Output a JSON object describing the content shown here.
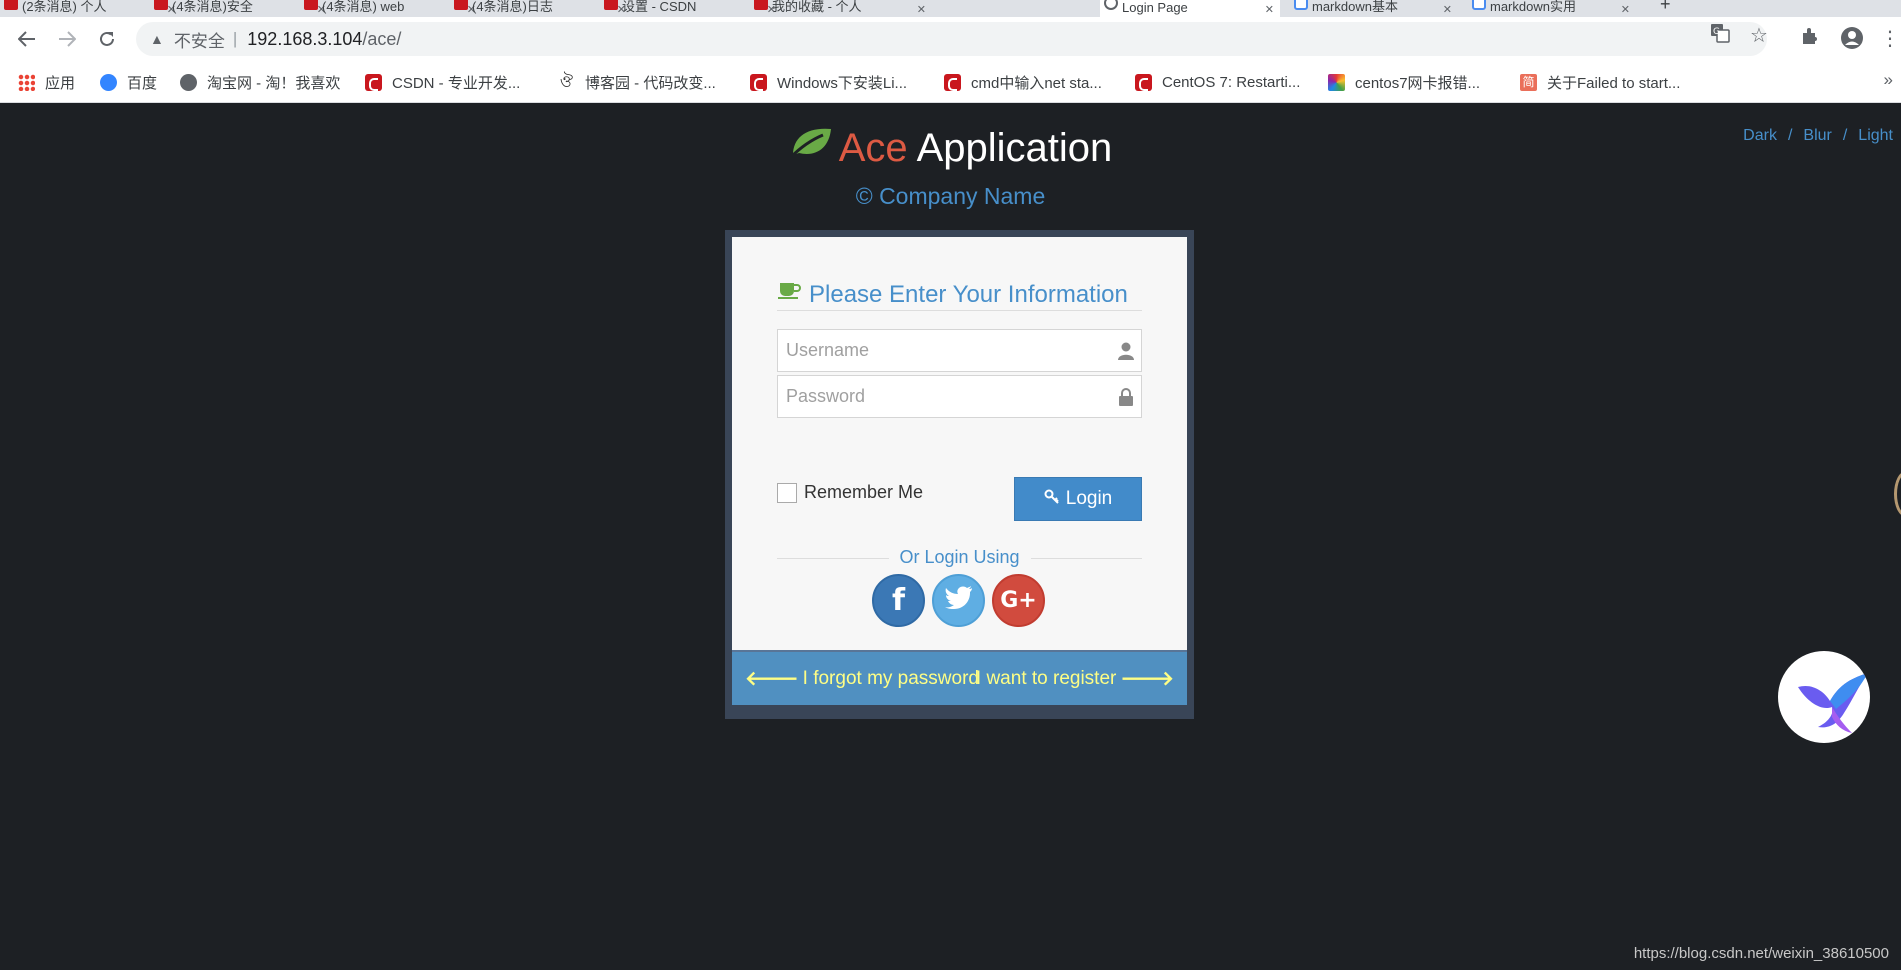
{
  "browser": {
    "tabs": [
      {
        "label": "(2条消息) 个人"
      },
      {
        "label": "(4条消息)安全"
      },
      {
        "label": "(4条消息) web"
      },
      {
        "label": "(4条消息)日志"
      },
      {
        "label": "设置 - CSDN"
      },
      {
        "label": "我的收藏 - 个人"
      },
      {
        "label": "Login Page"
      },
      {
        "label": "markdown基本"
      },
      {
        "label": "markdown实用"
      }
    ],
    "address": {
      "security_label": "不安全",
      "host": "192.168.3.104",
      "path": "/ace/"
    },
    "bookmarks": [
      {
        "label": "应用",
        "icon": "apps-grid-icon"
      },
      {
        "label": "百度",
        "icon": "baidu-paw-icon"
      },
      {
        "label": "淘宝网 - 淘！我喜欢",
        "icon": "globe-icon"
      },
      {
        "label": "CSDN - 专业开发...",
        "icon": "csdn-icon"
      },
      {
        "label": "博客园 - 代码改变...",
        "icon": "cnblogs-icon"
      },
      {
        "label": "Windows下安装Li...",
        "icon": "csdn-icon"
      },
      {
        "label": "cmd中输入net sta...",
        "icon": "csdn-icon"
      },
      {
        "label": "CentOS 7: Restarti...",
        "icon": "csdn-icon"
      },
      {
        "label": "centos7网卡报错...",
        "icon": "rainbow-icon"
      },
      {
        "label": "关于Failed to start...",
        "icon": "jianshu-icon"
      }
    ],
    "bookmarks_more": "»"
  },
  "page": {
    "theme_switch": [
      "Dark",
      "Blur",
      "Light"
    ],
    "theme_separator": "/",
    "brand": {
      "accent": "Ace",
      "rest": "Application"
    },
    "company": "© Company Name",
    "login": {
      "title": "Please Enter Your Information",
      "username_placeholder": "Username",
      "password_placeholder": "Password",
      "remember_label": "Remember Me",
      "login_button": "Login",
      "or_login_using": "Or Login Using",
      "social": {
        "facebook": "f",
        "twitter": "t",
        "google": "G+"
      },
      "forgot_link": "I forgot my password",
      "register_link": "I want to register"
    },
    "watermark": "https://blog.csdn.net/weixin_38610500"
  },
  "colors": {
    "page_bg": "#1d2024",
    "brand_accent": "#dd5a43",
    "link_blue": "#478fca",
    "primary_button": "#428bca",
    "toolbar_bg": "#5090c1",
    "toolbar_link": "#fefe85",
    "facebook": "#3b78b5",
    "twitter": "#5faee3",
    "google_plus": "#d14b3e"
  }
}
